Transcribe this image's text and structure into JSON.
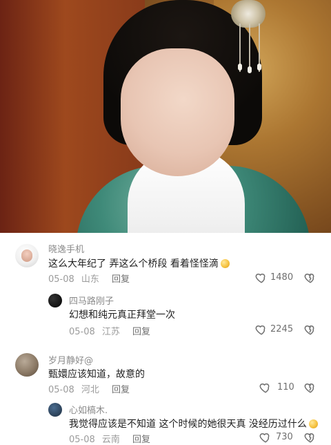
{
  "comments": [
    {
      "username": "晓逸手机",
      "text": "这么大年纪了 弄这么个桥段 看着怪怪滴",
      "emoji": "😂",
      "date": "05-08",
      "location": "山东",
      "reply_label": "回复",
      "likes": "1480",
      "avatar_icon": "user-avatar-icon"
    },
    {
      "username": "四马路刚子",
      "text": "幻想和纯元真正拜堂一次",
      "date": "05-08",
      "location": "江苏",
      "reply_label": "回复",
      "likes": "2245",
      "avatar_icon": "user-avatar-icon"
    },
    {
      "username": "岁月静好@",
      "text": "甄嬛应该知道，故意的",
      "date": "05-08",
      "location": "河北",
      "reply_label": "回复",
      "likes": "110",
      "avatar_icon": "user-avatar-icon"
    },
    {
      "username": "心如槁木.",
      "text": "我觉得应该是不知道 这个时候的她很天真 没经历过什么",
      "emoji": "😂",
      "date": "05-08",
      "location": "云南",
      "reply_label": "回复",
      "likes": "730",
      "avatar_icon": "user-avatar-icon"
    }
  ],
  "icons": {
    "like": "heart-outline-icon",
    "dislike": "broken-heart-outline-icon"
  },
  "colors": {
    "text_primary": "#1f1f1f",
    "text_secondary": "#8b8b8b",
    "text_meta": "#9b9b9b",
    "icon": "#6f6f6f"
  }
}
